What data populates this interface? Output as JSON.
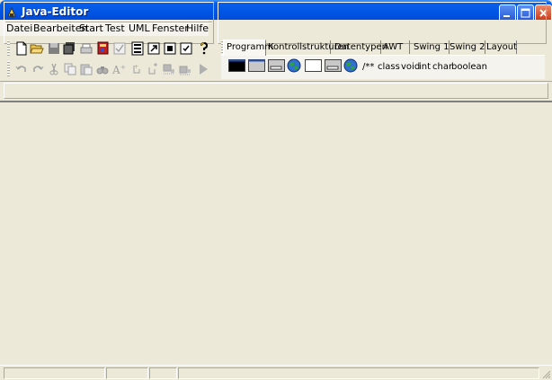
{
  "window": {
    "title": "Java-Editor",
    "buttons": {
      "minimize": "minimize",
      "maximize": "maximize",
      "close": "close"
    },
    "title_color": "#0055E5"
  },
  "menu": [
    {
      "label": "Datei"
    },
    {
      "label": "Bearbeiten"
    },
    {
      "label": "Start"
    },
    {
      "label": "Test"
    },
    {
      "label": "UML"
    },
    {
      "label": "Fenster"
    },
    {
      "label": "Hilfe"
    }
  ],
  "toolbar": {
    "row1": [
      "new-file-icon",
      "open-folder-icon",
      "save-icon",
      "save-all-icon",
      "print-icon",
      "compile-icon",
      "check-icon",
      "run-browser-icon",
      "run-icon",
      "export-icon",
      "checklist-icon",
      "help-icon"
    ],
    "row2": [
      "undo-icon",
      "redo-icon",
      "cut-icon",
      "copy-icon",
      "paste-icon",
      "find-icon",
      "font-icon",
      "tool-a-icon",
      "tool-b-icon",
      "tool-c-icon",
      "tool-d-icon",
      "play-icon"
    ]
  },
  "component_tabs": [
    {
      "label": "Programm",
      "active": true
    },
    {
      "label": "Kontrollstrukturen"
    },
    {
      "label": "Datentypen"
    },
    {
      "label": "AWT"
    },
    {
      "label": "Swing 1"
    },
    {
      "label": "Swing 2"
    },
    {
      "label": "Layout"
    }
  ],
  "palette": {
    "icons": [
      "console-app-icon",
      "frame-icon",
      "dialog-icon",
      "applet-icon",
      "window-icon",
      "panel-icon",
      "applet-globe-icon"
    ],
    "keywords": [
      "/**",
      "class",
      "void",
      "int",
      "char",
      "boolean"
    ]
  }
}
